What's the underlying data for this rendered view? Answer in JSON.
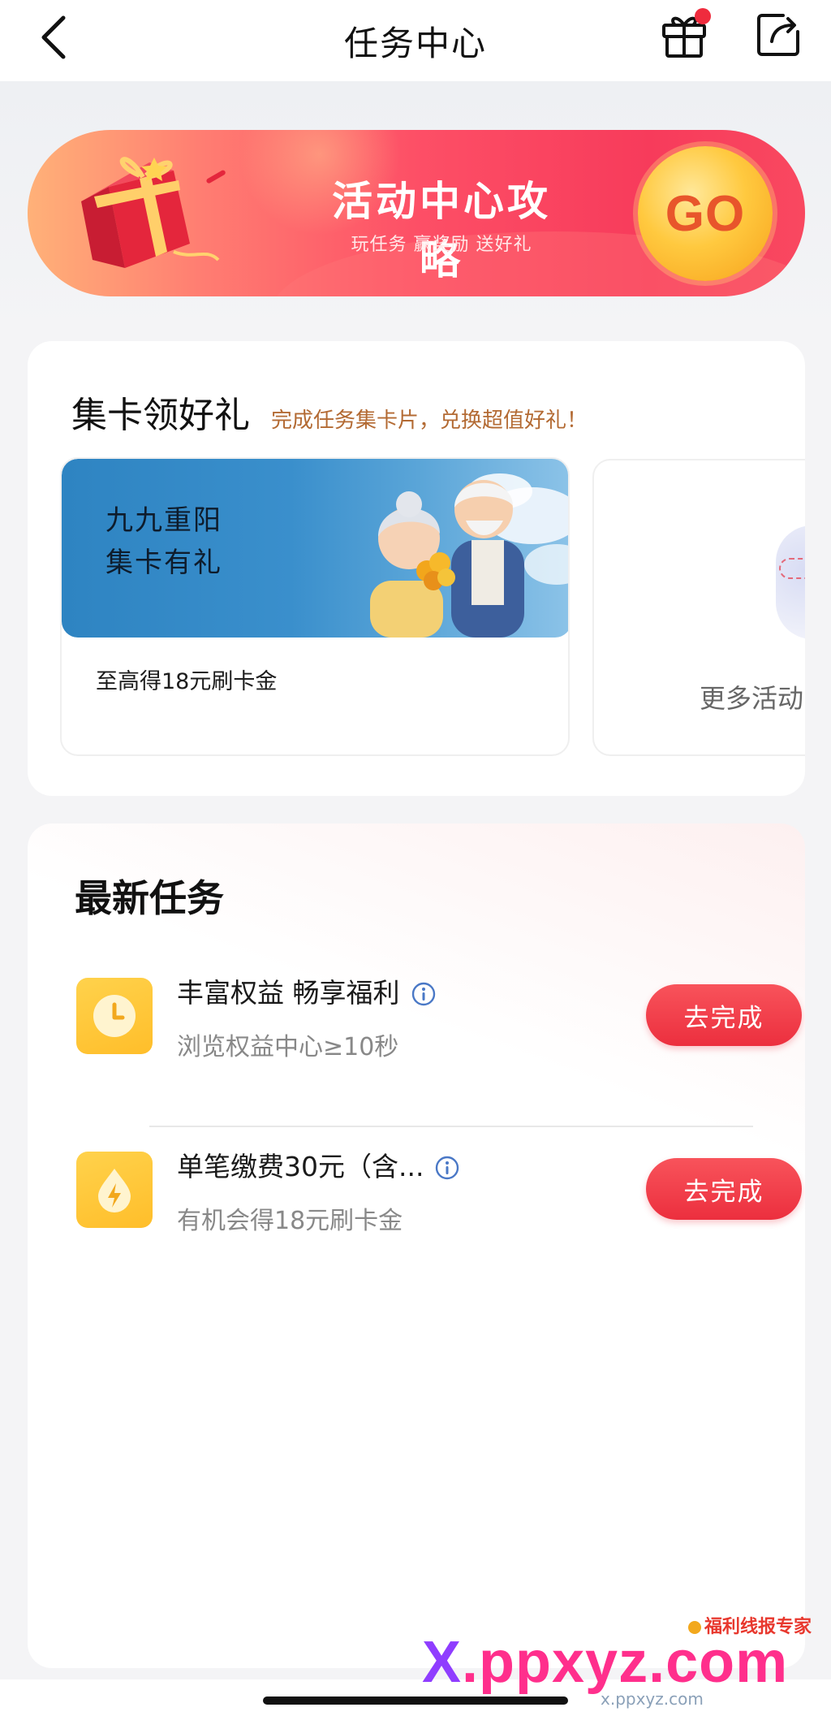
{
  "header": {
    "title": "任务中心",
    "back_icon": "back-icon",
    "gift_icon": "gift-icon",
    "share_icon": "share-icon",
    "badge_color": "#ef2b3d"
  },
  "banner": {
    "title": "活动中心攻略",
    "subtitle": "玩任务 赢奖励 送好礼",
    "go_label": "GO"
  },
  "card_section": {
    "title": "集卡领好礼",
    "description": "完成任务集卡片，兑换超值好礼！",
    "activity": {
      "hero_line1": "九九重阳",
      "hero_line2": "集卡有礼",
      "reward_text": "至高得18元刷卡金"
    },
    "more_label": "更多活动"
  },
  "tasks": {
    "title": "最新任务",
    "items": [
      {
        "title": "丰富权益 畅享福利",
        "description": "浏览权益中心≥10秒",
        "button_label": "去完成",
        "icon": "clock-icon"
      },
      {
        "title": "单笔缴费30元（含...",
        "description": "有机会得18元刷卡金",
        "button_label": "去完成",
        "icon": "lightning-drop-icon"
      }
    ]
  },
  "watermark": {
    "brand": "福利线报专家",
    "main_x": "X",
    "main_rest": ".ppxyz.com",
    "sub": "x.ppxyz.com"
  },
  "colors": {
    "accent_red": "#ec2f3e",
    "banner_start": "#ffb178",
    "banner_end": "#f73b5b",
    "task_icon_yellow": "#ffc53a",
    "section_desc_brown": "#b36a33"
  }
}
